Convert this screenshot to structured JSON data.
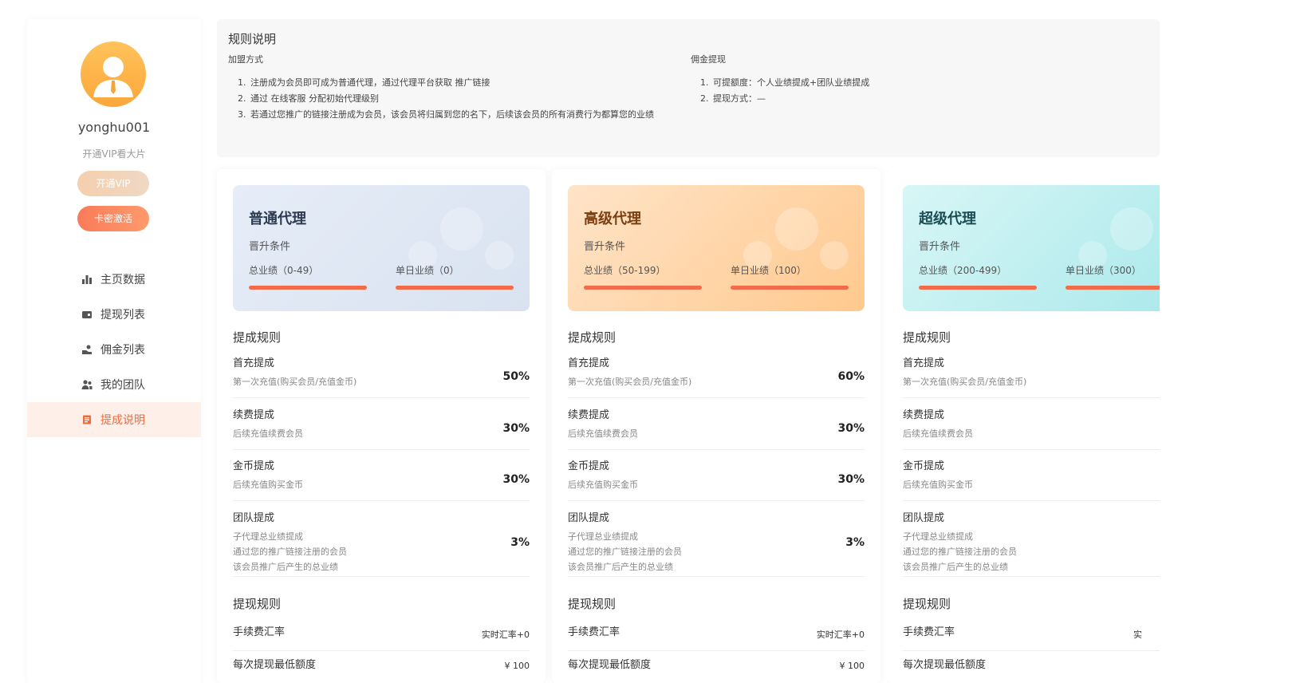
{
  "sidebar": {
    "username": "yonghu001",
    "vip_tip": "开通VIP看大片",
    "vip_button": "开通VIP",
    "card_button": "卡密激活",
    "nav": [
      {
        "label": "主页数据",
        "icon": "bar-chart-icon"
      },
      {
        "label": "提现列表",
        "icon": "wallet-icon"
      },
      {
        "label": "佣金列表",
        "icon": "hand-coin-icon"
      },
      {
        "label": "我的团队",
        "icon": "team-icon"
      },
      {
        "label": "提成说明",
        "icon": "document-icon",
        "active": true
      }
    ]
  },
  "rules": {
    "title": "规则说明",
    "join": {
      "heading": "加盟方式",
      "items": [
        "注册成为会员即可成为普通代理，通过代理平台获取 推广链接",
        "通过 在线客服 分配初始代理级别",
        "若通过您推广的链接注册成为会员，该会员将归属到您的名下，后续该会员的所有消费行为都算您的业绩"
      ]
    },
    "withdraw": {
      "heading": "佣金提现",
      "items": [
        "可提额度：个人业绩提成+团队业绩提成",
        "提现方式：—"
      ]
    }
  },
  "cards": [
    {
      "level": "普通代理",
      "cond_label": "晋升条件",
      "total": "总业绩（0-49）",
      "daily": "单日业绩（0）",
      "commission_title": "提成规则",
      "first": {
        "title": "首充提成",
        "desc": "第一次充值(购买会员/充值金币)",
        "value": "50%"
      },
      "renew": {
        "title": "续费提成",
        "desc": "后续充值续费会员",
        "value": "30%"
      },
      "coin": {
        "title": "金币提成",
        "desc": "后续充值购买金币",
        "value": "30%"
      },
      "team": {
        "title": "团队提成",
        "desc1": "子代理总业绩提成",
        "desc2": "通过您的推广链接注册的会员",
        "desc3": "该会员推广后产生的总业绩",
        "value": "3%"
      },
      "withdraw_title": "提现规则",
      "fee": {
        "title": "手续费汇率",
        "value": "实时汇率+0"
      },
      "min": {
        "title": "每次提现最低额度",
        "value": "¥ 100"
      }
    },
    {
      "level": "高级代理",
      "cond_label": "晋升条件",
      "total": "总业绩（50-199）",
      "daily": "单日业绩（100）",
      "commission_title": "提成规则",
      "first": {
        "title": "首充提成",
        "desc": "第一次充值(购买会员/充值金币)",
        "value": "60%"
      },
      "renew": {
        "title": "续费提成",
        "desc": "后续充值续费会员",
        "value": "30%"
      },
      "coin": {
        "title": "金币提成",
        "desc": "后续充值购买金币",
        "value": "30%"
      },
      "team": {
        "title": "团队提成",
        "desc1": "子代理总业绩提成",
        "desc2": "通过您的推广链接注册的会员",
        "desc3": "该会员推广后产生的总业绩",
        "value": "3%"
      },
      "withdraw_title": "提现规则",
      "fee": {
        "title": "手续费汇率",
        "value": "实时汇率+0"
      },
      "min": {
        "title": "每次提现最低额度",
        "value": "¥ 100"
      }
    },
    {
      "level": "超级代理",
      "cond_label": "晋升条件",
      "total": "总业绩（200-499）",
      "daily": "单日业绩（300）",
      "commission_title": "提成规则",
      "first": {
        "title": "首充提成",
        "desc": "第一次充值(购买会员/充值金币)",
        "value": ""
      },
      "renew": {
        "title": "续费提成",
        "desc": "后续充值续费会员",
        "value": ""
      },
      "coin": {
        "title": "金币提成",
        "desc": "后续充值购买金币",
        "value": ""
      },
      "team": {
        "title": "团队提成",
        "desc1": "子代理总业绩提成",
        "desc2": "通过您的推广链接注册的会员",
        "desc3": "该会员推广后产生的总业绩",
        "value": ""
      },
      "withdraw_title": "提现规则",
      "fee": {
        "title": "手续费汇率",
        "value": "实"
      },
      "min": {
        "title": "每次提现最低额度",
        "value": ""
      }
    }
  ],
  "colors": {
    "accent": "#f06a3a",
    "bar": "#f26b4a",
    "active_bg": "#fef0e8"
  }
}
